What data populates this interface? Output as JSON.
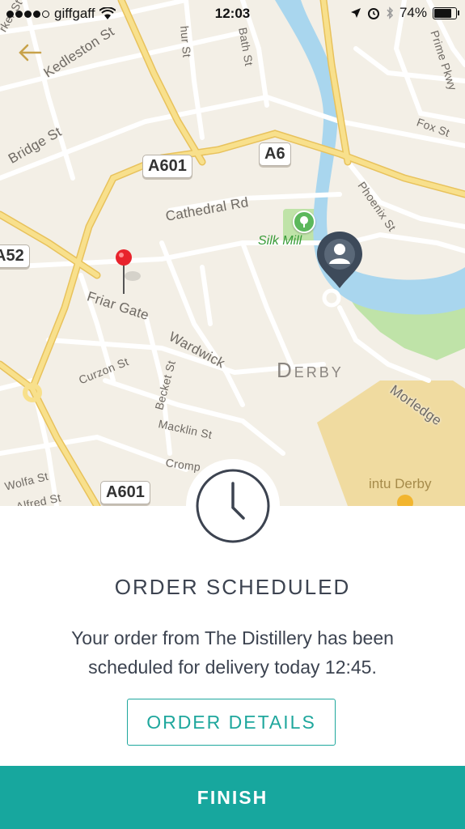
{
  "status_bar": {
    "carrier": "giffgaff",
    "time": "12:03",
    "battery": "74%",
    "signal_bars": 4
  },
  "map": {
    "road_shields": [
      "A601",
      "A6",
      "A52",
      "A601"
    ],
    "road_labels": [
      "Kedleston St",
      "Bridge St",
      "Cathedral Rd",
      "Friar Gate",
      "Wardwick",
      "Curzon St",
      "Becket St",
      "Macklin St",
      "Wolfa St",
      "Alfred St",
      "Phoenix St",
      "Fox St",
      "Morledge",
      "Prime Pkwy",
      "Cromp",
      "Bath St",
      "hur St",
      "rker St"
    ],
    "city_label": "Derby",
    "poi_labels": [
      "Silk Mill",
      "intu Derby"
    ],
    "colors": {
      "land": "#f3efe6",
      "river": "#a9d6ee",
      "park": "#bfe3a8",
      "shopping": "#f0dba0",
      "major_road": "#f6d67a",
      "pin": "#e8232c",
      "location_marker": "#3d4a5a"
    }
  },
  "sheet": {
    "title": "ORDER SCHEDULED",
    "message": "Your order from The Distillery has been scheduled for delivery today 12:45.",
    "details_button": "ORDER DETAILS",
    "finish_button": "FINISH",
    "accent_color": "#17a79e"
  }
}
